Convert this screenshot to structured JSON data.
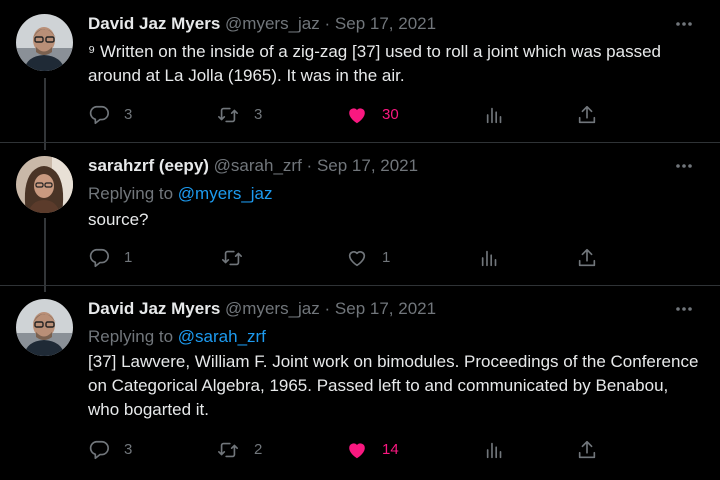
{
  "colors": {
    "background": "#000000",
    "text": "#e7e9ea",
    "muted": "#71767b",
    "mention": "#1d9bf0",
    "like_active": "#f91880",
    "divider": "#2f3336"
  },
  "tweets": [
    {
      "author_name": "David Jaz Myers",
      "author_handle": "@myers_jaz",
      "separator": "·",
      "date": "Sep 17, 2021",
      "more_icon": "more-dots-icon",
      "body": "⁹ Written on the inside of a zig-zag [37] used to roll a joint which was passed around at La Jolla (1965). It was in the air.",
      "replies": "3",
      "retweets": "3",
      "likes": "30",
      "liked": true
    },
    {
      "author_name": "sarahzrf (eepy)",
      "author_handle": "@sarah_zrf",
      "separator": "·",
      "date": "Sep 17, 2021",
      "more_icon": "more-dots-icon",
      "replying_prefix": "Replying to ",
      "replying_to": "@myers_jaz",
      "body": "source?",
      "replies": "1",
      "retweets": "",
      "likes": "1",
      "liked": false
    },
    {
      "author_name": "David Jaz Myers",
      "author_handle": "@myers_jaz",
      "separator": "·",
      "date": "Sep 17, 2021",
      "more_icon": "more-dots-icon",
      "replying_prefix": "Replying to ",
      "replying_to": "@sarah_zrf",
      "body": "[37] Lawvere, William F. Joint work on bimodules. Proceedings of the Conference on Categorical Algebra, 1965. Passed left to and communicated by Benabou, who bogarted it.",
      "replies": "3",
      "retweets": "2",
      "likes": "14",
      "liked": true
    }
  ]
}
